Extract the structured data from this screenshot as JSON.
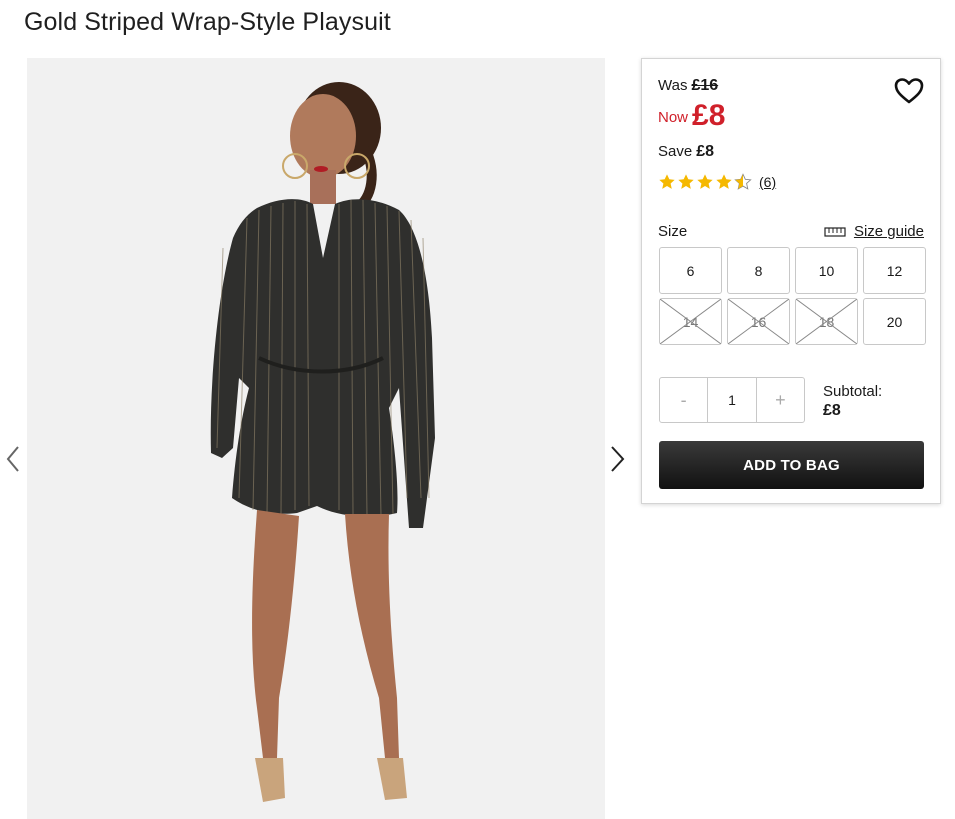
{
  "product": {
    "title": "Gold Striped Wrap-Style Playsuit"
  },
  "gallery": {
    "prev_icon": "chevron-left-icon",
    "next_icon": "chevron-right-icon"
  },
  "pricing": {
    "was_label": "Was",
    "was_price": "£16",
    "now_label": "Now",
    "now_price": "£8",
    "now_color": "#d0202a",
    "save_label": "Save",
    "save_amount": "£8"
  },
  "rating": {
    "stars": 4.5,
    "max": 5,
    "count": "(6)",
    "star_color": "#f5b800"
  },
  "size": {
    "label": "Size",
    "guide_label": "Size guide",
    "options": [
      {
        "label": "6",
        "available": true
      },
      {
        "label": "8",
        "available": true
      },
      {
        "label": "10",
        "available": true
      },
      {
        "label": "12",
        "available": true
      },
      {
        "label": "14",
        "available": false
      },
      {
        "label": "16",
        "available": false
      },
      {
        "label": "18",
        "available": false
      },
      {
        "label": "20",
        "available": true
      }
    ]
  },
  "quantity": {
    "minus": "-",
    "value": "1",
    "plus": "+"
  },
  "subtotal": {
    "label": "Subtotal:",
    "value": "£8"
  },
  "cart": {
    "add_label": "ADD TO BAG"
  }
}
